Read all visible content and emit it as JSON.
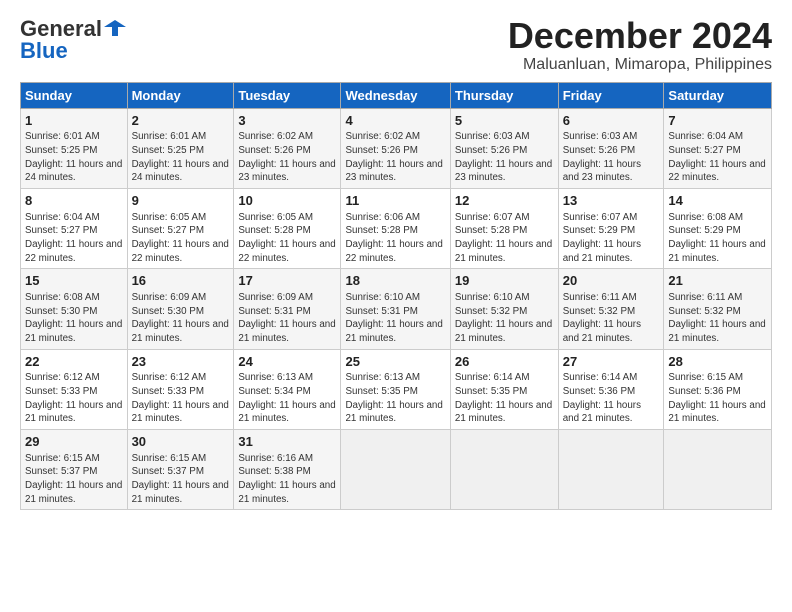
{
  "header": {
    "logo_general": "General",
    "logo_blue": "Blue",
    "title": "December 2024",
    "subtitle": "Maluanluan, Mimaropa, Philippines"
  },
  "calendar": {
    "days_of_week": [
      "Sunday",
      "Monday",
      "Tuesday",
      "Wednesday",
      "Thursday",
      "Friday",
      "Saturday"
    ],
    "weeks": [
      [
        {
          "day": "",
          "detail": ""
        },
        {
          "day": "2",
          "detail": "Sunrise: 6:01 AM\nSunset: 5:25 PM\nDaylight: 11 hours\nand 24 minutes."
        },
        {
          "day": "3",
          "detail": "Sunrise: 6:02 AM\nSunset: 5:26 PM\nDaylight: 11 hours\nand 23 minutes."
        },
        {
          "day": "4",
          "detail": "Sunrise: 6:02 AM\nSunset: 5:26 PM\nDaylight: 11 hours\nand 23 minutes."
        },
        {
          "day": "5",
          "detail": "Sunrise: 6:03 AM\nSunset: 5:26 PM\nDaylight: 11 hours\nand 23 minutes."
        },
        {
          "day": "6",
          "detail": "Sunrise: 6:03 AM\nSunset: 5:26 PM\nDaylight: 11 hours\nand 23 minutes."
        },
        {
          "day": "7",
          "detail": "Sunrise: 6:04 AM\nSunset: 5:27 PM\nDaylight: 11 hours\nand 22 minutes."
        }
      ],
      [
        {
          "day": "1",
          "detail": "Sunrise: 6:01 AM\nSunset: 5:25 PM\nDaylight: 11 hours\nand 24 minutes."
        },
        {
          "day": "9",
          "detail": "Sunrise: 6:05 AM\nSunset: 5:27 PM\nDaylight: 11 hours\nand 22 minutes."
        },
        {
          "day": "10",
          "detail": "Sunrise: 6:05 AM\nSunset: 5:28 PM\nDaylight: 11 hours\nand 22 minutes."
        },
        {
          "day": "11",
          "detail": "Sunrise: 6:06 AM\nSunset: 5:28 PM\nDaylight: 11 hours\nand 22 minutes."
        },
        {
          "day": "12",
          "detail": "Sunrise: 6:07 AM\nSunset: 5:28 PM\nDaylight: 11 hours\nand 21 minutes."
        },
        {
          "day": "13",
          "detail": "Sunrise: 6:07 AM\nSunset: 5:29 PM\nDaylight: 11 hours\nand 21 minutes."
        },
        {
          "day": "14",
          "detail": "Sunrise: 6:08 AM\nSunset: 5:29 PM\nDaylight: 11 hours\nand 21 minutes."
        }
      ],
      [
        {
          "day": "8",
          "detail": "Sunrise: 6:04 AM\nSunset: 5:27 PM\nDaylight: 11 hours\nand 22 minutes."
        },
        {
          "day": "16",
          "detail": "Sunrise: 6:09 AM\nSunset: 5:30 PM\nDaylight: 11 hours\nand 21 minutes."
        },
        {
          "day": "17",
          "detail": "Sunrise: 6:09 AM\nSunset: 5:31 PM\nDaylight: 11 hours\nand 21 minutes."
        },
        {
          "day": "18",
          "detail": "Sunrise: 6:10 AM\nSunset: 5:31 PM\nDaylight: 11 hours\nand 21 minutes."
        },
        {
          "day": "19",
          "detail": "Sunrise: 6:10 AM\nSunset: 5:32 PM\nDaylight: 11 hours\nand 21 minutes."
        },
        {
          "day": "20",
          "detail": "Sunrise: 6:11 AM\nSunset: 5:32 PM\nDaylight: 11 hours\nand 21 minutes."
        },
        {
          "day": "21",
          "detail": "Sunrise: 6:11 AM\nSunset: 5:32 PM\nDaylight: 11 hours\nand 21 minutes."
        }
      ],
      [
        {
          "day": "15",
          "detail": "Sunrise: 6:08 AM\nSunset: 5:30 PM\nDaylight: 11 hours\nand 21 minutes."
        },
        {
          "day": "23",
          "detail": "Sunrise: 6:12 AM\nSunset: 5:33 PM\nDaylight: 11 hours\nand 21 minutes."
        },
        {
          "day": "24",
          "detail": "Sunrise: 6:13 AM\nSunset: 5:34 PM\nDaylight: 11 hours\nand 21 minutes."
        },
        {
          "day": "25",
          "detail": "Sunrise: 6:13 AM\nSunset: 5:35 PM\nDaylight: 11 hours\nand 21 minutes."
        },
        {
          "day": "26",
          "detail": "Sunrise: 6:14 AM\nSunset: 5:35 PM\nDaylight: 11 hours\nand 21 minutes."
        },
        {
          "day": "27",
          "detail": "Sunrise: 6:14 AM\nSunset: 5:36 PM\nDaylight: 11 hours\nand 21 minutes."
        },
        {
          "day": "28",
          "detail": "Sunrise: 6:15 AM\nSunset: 5:36 PM\nDaylight: 11 hours\nand 21 minutes."
        }
      ],
      [
        {
          "day": "22",
          "detail": "Sunrise: 6:12 AM\nSunset: 5:33 PM\nDaylight: 11 hours\nand 21 minutes."
        },
        {
          "day": "30",
          "detail": "Sunrise: 6:15 AM\nSunset: 5:37 PM\nDaylight: 11 hours\nand 21 minutes."
        },
        {
          "day": "31",
          "detail": "Sunrise: 6:16 AM\nSunset: 5:38 PM\nDaylight: 11 hours\nand 21 minutes."
        },
        {
          "day": "",
          "detail": ""
        },
        {
          "day": "",
          "detail": ""
        },
        {
          "day": "",
          "detail": ""
        },
        {
          "day": ""
        }
      ],
      [
        {
          "day": "29",
          "detail": "Sunrise: 6:15 AM\nSunset: 5:37 PM\nDaylight: 11 hours\nand 21 minutes."
        },
        {
          "day": "",
          "detail": ""
        },
        {
          "day": "",
          "detail": ""
        },
        {
          "day": "",
          "detail": ""
        },
        {
          "day": "",
          "detail": ""
        },
        {
          "day": "",
          "detail": ""
        },
        {
          "day": "",
          "detail": ""
        }
      ]
    ]
  }
}
